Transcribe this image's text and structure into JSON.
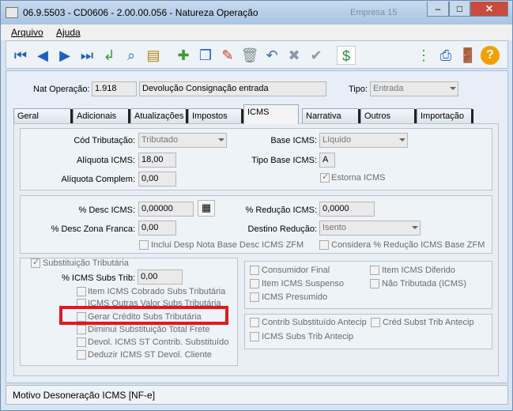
{
  "window": {
    "title": "06.9.5503 - CD0606 - 2.00.00.056 - Natureza Operação",
    "background_title": "Empresa 15"
  },
  "menu": {
    "arquivo": "Arquivo",
    "ajuda": "Ajuda"
  },
  "header": {
    "nat_label": "Nat Operação:",
    "nat_code": "1.918",
    "nat_desc": "Devolução Consignação entrada",
    "tipo_label": "Tipo:",
    "tipo_value": "Entrada"
  },
  "tabs": [
    "Geral",
    "Adicionais",
    "Atualizações",
    "Impostos",
    "ICMS",
    "Narrativa",
    "Outros",
    "Importação"
  ],
  "icms": {
    "cod_trib_label": "Cód Tributação:",
    "cod_trib_value": "Tributado",
    "aliquota_label": "Alíquota ICMS:",
    "aliquota_value": "18,00",
    "aliquota_compl_label": "Alíquota Complem:",
    "aliquota_compl_value": "0,00",
    "base_label": "Base ICMS:",
    "base_value": "Líquido",
    "tipo_base_label": "Tipo Base ICMS:",
    "tipo_base_value": "A",
    "estorna_label": "Estorna ICMS"
  },
  "desc": {
    "desc_icms_label": "% Desc ICMS:",
    "desc_icms_value": "0,00000",
    "desc_zona_label": "% Desc Zona Franca:",
    "desc_zona_value": "0,00",
    "reducao_label": "% Redução ICMS:",
    "reducao_value": "0,0000",
    "destino_label": "Destino Redução:",
    "destino_value": "Isento",
    "inclui_label": "Inclui Desp Nota Base Desc ICMS ZFM",
    "considera_label": "Considera % Redução ICMS Base ZFM"
  },
  "subst": {
    "group_label": "Substituição Tributária",
    "icms_subs_label": "% ICMS Subs Trib:",
    "icms_subs_value": "0,00",
    "options": [
      "Item ICMS Cobrado Subs Tributária",
      "ICMS Outras Valor Subs Tributária",
      "Gerar Crédito Subs Tributária",
      "Diminui Substituição Total Frete",
      "Devol. ICMS ST Contrib. Substituído",
      "Deduzir ICMS ST Devol. Cliente"
    ]
  },
  "right_options": {
    "consumidor_final": "Consumidor Final",
    "item_diferido": "Item ICMS Diferido",
    "item_suspenso": "Item ICMS Suspenso",
    "nao_tributada": "Não Tributada (ICMS)",
    "icms_presumido": "ICMS Presumido",
    "contrib_subst": "Contrib Substituído Antecip",
    "cred_subst": "Créd Subst Trib Antecip",
    "icms_subs_antecip": "ICMS Subs Trib Antecip"
  },
  "status": {
    "text": "Motivo Desoneração ICMS [NF-e]"
  },
  "colors": {
    "highlight": "#e0191f",
    "accent": "#1f5fbf"
  }
}
